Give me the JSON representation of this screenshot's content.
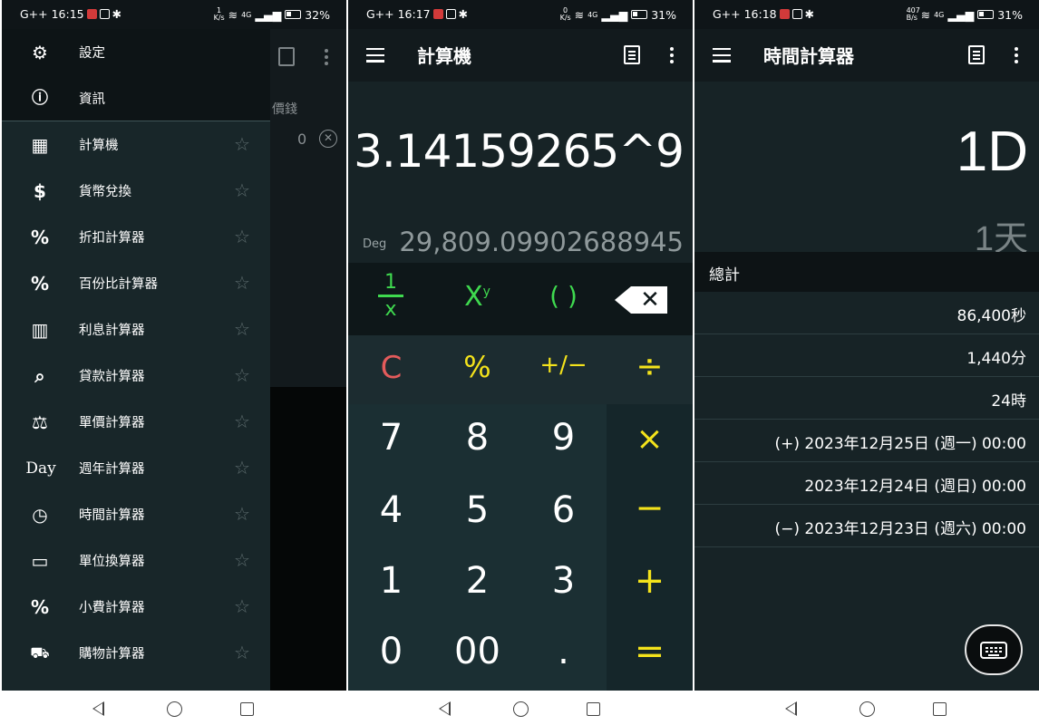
{
  "panel1": {
    "status": {
      "carrier_time": "G++ 16:15",
      "speed_top": "1",
      "speed_bottom": "K/s",
      "signal": "4G",
      "battery": "32%"
    },
    "drawer_top": [
      {
        "label": "設定",
        "icon": "gear-icon"
      },
      {
        "label": "資訊",
        "icon": "info-icon"
      }
    ],
    "drawer_items": [
      {
        "label": "計算機",
        "icon": "calculator-icon",
        "glyph": "▦"
      },
      {
        "label": "貨幣兌換",
        "icon": "dollar-icon",
        "glyph": "$"
      },
      {
        "label": "折扣計算器",
        "icon": "discount-bag-icon",
        "glyph": "%"
      },
      {
        "label": "百份比計算器",
        "icon": "percent-icon",
        "glyph": "%"
      },
      {
        "label": "利息計算器",
        "icon": "interest-icon",
        "glyph": "▥"
      },
      {
        "label": "貸款計算器",
        "icon": "loan-icon",
        "glyph": "⌕"
      },
      {
        "label": "單價計算器",
        "icon": "scale-icon",
        "glyph": "⚖"
      },
      {
        "label": "週年計算器",
        "icon": "day-icon",
        "glyph": "Day"
      },
      {
        "label": "時間計算器",
        "icon": "clock-icon",
        "glyph": "◷"
      },
      {
        "label": "單位換算器",
        "icon": "ruler-icon",
        "glyph": "▭"
      },
      {
        "label": "小費計算器",
        "icon": "tip-icon",
        "glyph": "%"
      },
      {
        "label": "購物計算器",
        "icon": "cart-icon",
        "glyph": "🛒"
      }
    ],
    "background_partial_text": "價錢",
    "background_partial_value": "0"
  },
  "panel2": {
    "status": {
      "carrier_time": "G++ 16:17",
      "speed_top": "0",
      "speed_bottom": "K/s",
      "signal": "4G",
      "battery": "31%"
    },
    "title": "計算機",
    "expression": "3.14159265^9",
    "angle_mode": "Deg",
    "result": "29,809.09902688945",
    "keys": {
      "reciprocal_top": "1",
      "reciprocal_bottom": "x",
      "power": "X",
      "power_sup": "y",
      "parens": "( )",
      "clear": "C",
      "percent": "%",
      "plusminus": "+/−",
      "divide": "÷",
      "k7": "7",
      "k8": "8",
      "k9": "9",
      "multiply": "×",
      "k4": "4",
      "k5": "5",
      "k6": "6",
      "minus": "−",
      "k1": "1",
      "k2": "2",
      "k3": "3",
      "plus": "+",
      "k0": "0",
      "k00": "00",
      "dot": ".",
      "equals": "="
    }
  },
  "panel3": {
    "status": {
      "carrier_time": "G++ 16:18",
      "speed_top": "407",
      "speed_bottom": "B/s",
      "signal": "4G",
      "battery": "31%"
    },
    "title": "時間計算器",
    "main_value": "1D",
    "sub_value": "1天",
    "total_label": "總計",
    "rows": [
      "86,400秒",
      "1,440分",
      "24時",
      "(+) 2023年12月25日 (週一) 00:00",
      "2023年12月24日 (週日) 00:00",
      "(−) 2023年12月23日 (週六) 00:00"
    ]
  }
}
